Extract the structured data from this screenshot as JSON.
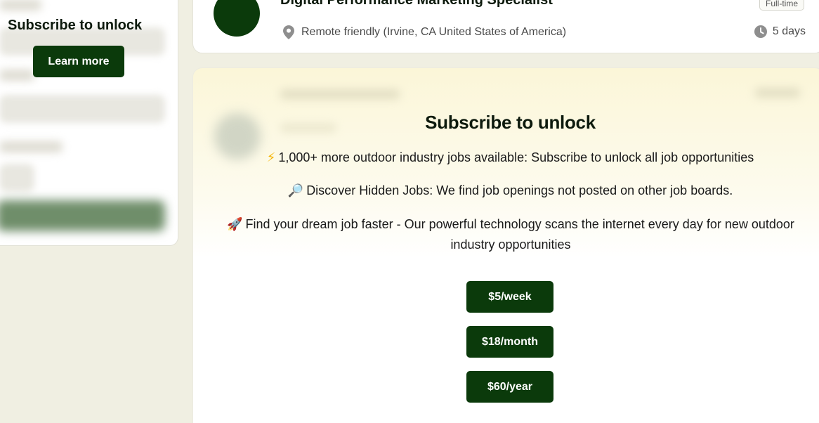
{
  "sidebar": {
    "title": "Subscribe to unlock",
    "learn_more_label": "Learn more"
  },
  "job": {
    "title": "Digital Performance Marketing Specialist",
    "location": "Remote friendly (Irvine, CA United States of America)",
    "type_badge": "Full-time",
    "posted_age": "5 days",
    "logo_color": "#0b3a0b"
  },
  "paywall": {
    "title": "Subscribe to unlock",
    "lines": [
      {
        "icon": "lightning-icon",
        "glyph": "⚡",
        "text": "1,000+ more outdoor industry jobs available: Subscribe to unlock all job opportunities"
      },
      {
        "icon": "magnifier-icon",
        "glyph": "🔎",
        "text": "Discover Hidden Jobs: We find job openings not posted on other job boards."
      },
      {
        "icon": "rocket-icon",
        "glyph": "🚀",
        "text": "Find your dream job faster - Our powerful technology scans the internet every day for new outdoor industry opportunities"
      }
    ],
    "prices": [
      {
        "label": "$5/week"
      },
      {
        "label": "$18/month"
      },
      {
        "label": "$60/year"
      }
    ]
  },
  "colors": {
    "accent": "#0b3a0b",
    "page_bg": "#f0efe2",
    "paywall_gradient_top": "#fbf6d8"
  }
}
